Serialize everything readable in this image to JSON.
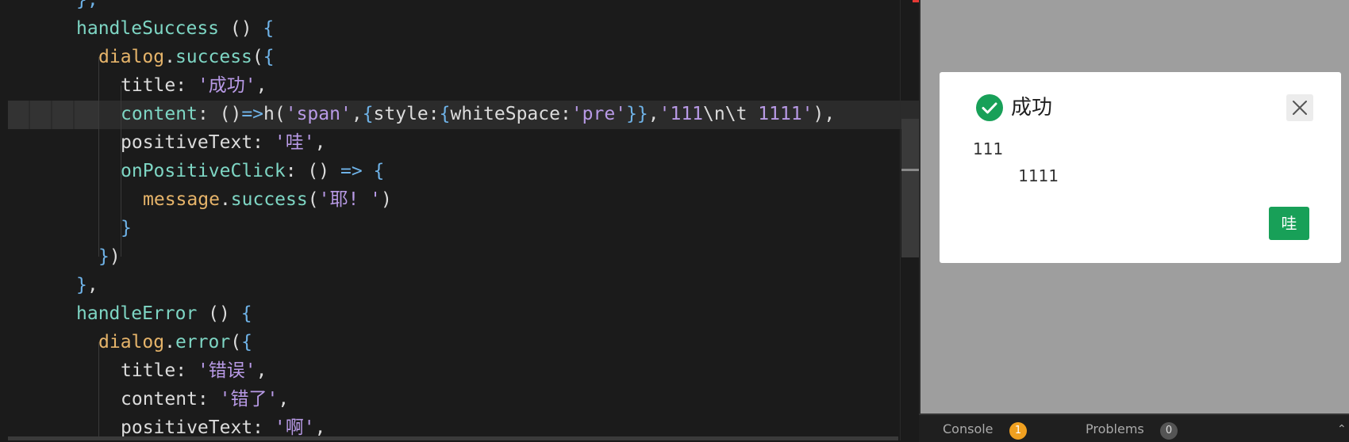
{
  "editor": {
    "lines": [
      [
        [
          "t-brace",
          "},"
        ]
      ],
      [
        [
          "t-fn",
          "handleSuccess"
        ],
        [
          "t-punc",
          " () "
        ],
        [
          "t-brace",
          "{"
        ]
      ],
      [
        [
          "t-obj",
          "dialog"
        ],
        [
          "t-punc",
          "."
        ],
        [
          "t-fn",
          "success"
        ],
        [
          "t-punc",
          "("
        ],
        [
          "t-brace",
          "{"
        ]
      ],
      [
        [
          "t-punc",
          "title: "
        ],
        [
          "t-str",
          "'成功'"
        ],
        [
          "t-punc",
          ","
        ]
      ],
      [
        [
          "t-key",
          "content"
        ],
        [
          "t-punc",
          ": ()"
        ],
        [
          "t-op",
          "=>"
        ],
        [
          "t-punc",
          "h("
        ],
        [
          "t-str",
          "'span'"
        ],
        [
          "t-punc",
          ","
        ],
        [
          "t-brace",
          "{"
        ],
        [
          "t-punc",
          "style:"
        ],
        [
          "t-brace",
          "{"
        ],
        [
          "t-punc",
          "whiteSpace:"
        ],
        [
          "t-str",
          "'pre'"
        ],
        [
          "t-brace",
          "}}"
        ],
        [
          "t-punc",
          ","
        ],
        [
          "t-str",
          "'111"
        ],
        [
          "t-punc",
          "\\n\\t "
        ],
        [
          "t-num",
          "1111"
        ],
        [
          "t-str",
          "'"
        ],
        [
          "t-punc",
          "),"
        ]
      ],
      [
        [
          "t-punc",
          "positiveText: "
        ],
        [
          "t-str",
          "'哇'"
        ],
        [
          "t-punc",
          ","
        ]
      ],
      [
        [
          "t-key",
          "onPositiveClick"
        ],
        [
          "t-punc",
          ": () "
        ],
        [
          "t-op",
          "=>"
        ],
        [
          "t-punc",
          " "
        ],
        [
          "t-brace",
          "{"
        ]
      ],
      [
        [
          "t-obj",
          "message"
        ],
        [
          "t-punc",
          "."
        ],
        [
          "t-fn",
          "success"
        ],
        [
          "t-punc",
          "("
        ],
        [
          "t-str",
          "'耶! '"
        ],
        [
          "t-punc",
          ")"
        ]
      ],
      [
        [
          "t-brace",
          "}"
        ]
      ],
      [
        [
          "t-brace",
          "}"
        ],
        [
          "t-punc",
          ")"
        ]
      ],
      [
        [
          "t-brace",
          "}"
        ],
        [
          "t-punc",
          ","
        ]
      ],
      [
        [
          "t-fn",
          "handleError"
        ],
        [
          "t-punc",
          " () "
        ],
        [
          "t-brace",
          "{"
        ]
      ],
      [
        [
          "t-obj",
          "dialog"
        ],
        [
          "t-punc",
          "."
        ],
        [
          "t-fn",
          "error"
        ],
        [
          "t-punc",
          "("
        ],
        [
          "t-brace",
          "{"
        ]
      ],
      [
        [
          "t-punc",
          "title: "
        ],
        [
          "t-str",
          "'错误'"
        ],
        [
          "t-punc",
          ","
        ]
      ],
      [
        [
          "t-punc",
          "content: "
        ],
        [
          "t-str",
          "'错了'"
        ],
        [
          "t-punc",
          ","
        ]
      ],
      [
        [
          "t-punc",
          "positiveText: "
        ],
        [
          "t-str",
          "'啊'"
        ],
        [
          "t-punc",
          ","
        ]
      ]
    ]
  },
  "dialog": {
    "title": "成功",
    "content": "111\n\t 1111",
    "positive_label": "哇",
    "icon": "success-check-icon",
    "accent": "#18a058"
  },
  "bottom_panel": {
    "console_label": "Console",
    "console_count": "1",
    "problems_label": "Problems",
    "problems_count": "0"
  }
}
